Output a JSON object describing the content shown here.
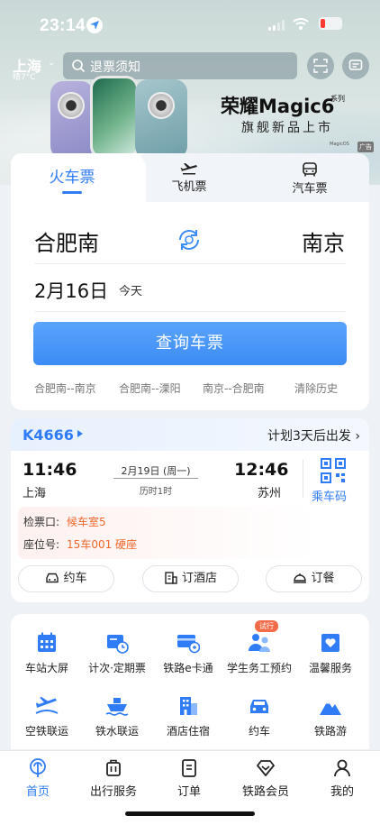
{
  "status_bar": {
    "time": "23:14"
  },
  "header": {
    "city": "上海",
    "weather": "晴7°C",
    "search_placeholder": "退票须知"
  },
  "ad": {
    "title": "荣耀Magic6",
    "series": "系列",
    "subtitle": "旗舰新品上市",
    "mini_text": "MagicOS",
    "tag": "广告"
  },
  "ticket": {
    "tabs": [
      "火车票",
      "飞机票",
      "汽车票"
    ],
    "from": "合肥南",
    "to": "南京",
    "date": "2月16日",
    "date_hint": "今天",
    "query_button": "查询车票",
    "history": [
      "合肥南--南京",
      "合肥南--溧阳",
      "南京--合肥南"
    ],
    "clear_history": "清除历史"
  },
  "trip": {
    "train_no": "K4666",
    "plan_text": "计划3天后出发",
    "depart_time": "11:46",
    "depart_station": "上海",
    "arrive_time": "12:46",
    "arrive_station": "苏州",
    "date": "2月19日 (周一)",
    "duration": "历时1时",
    "qr_label": "乘车码",
    "gate_label": "检票口:",
    "gate_value": "候车室5",
    "seat_label": "座位号:",
    "seat_value": "15车001 硬座",
    "actions": [
      "约车",
      "订酒店",
      "订餐"
    ]
  },
  "services": {
    "row1": [
      "车站大屏",
      "计次·定期票",
      "铁路e卡通",
      "学生务工预约",
      "温馨服务"
    ],
    "row2": [
      "空铁联运",
      "铁水联运",
      "酒店住宿",
      "约车",
      "铁路游"
    ],
    "badge": "试行"
  },
  "nav": [
    "首页",
    "出行服务",
    "订单",
    "铁路会员",
    "我的"
  ],
  "colors": {
    "accent": "#2f7cf6",
    "warning": "#f0662b"
  }
}
